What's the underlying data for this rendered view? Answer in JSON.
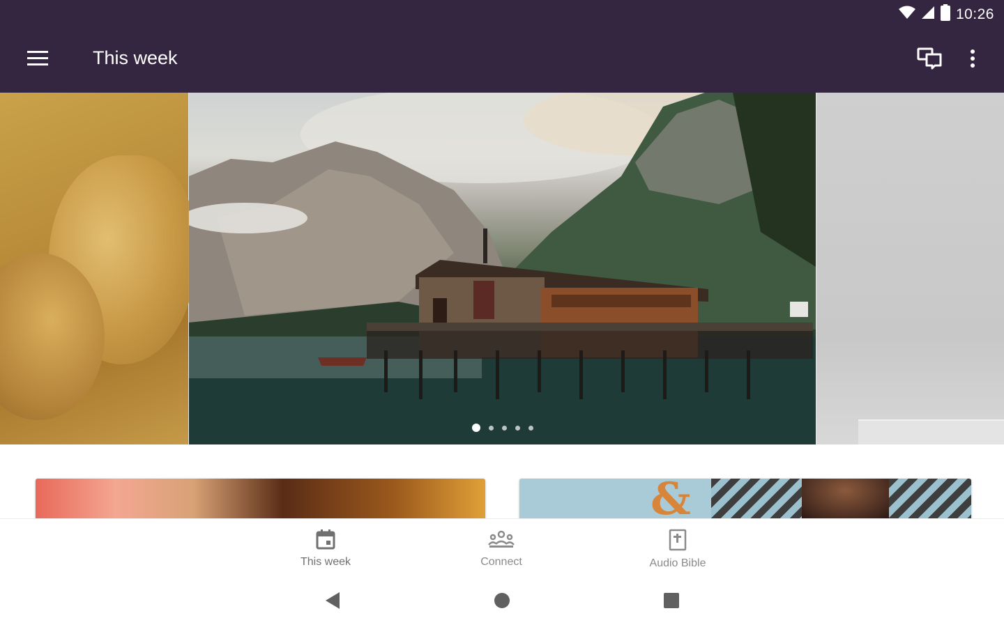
{
  "status_bar": {
    "time": "10:26",
    "icons": [
      "wifi-icon",
      "signal-icon",
      "battery-icon"
    ]
  },
  "app_bar": {
    "title": "This week",
    "icons": [
      "menu-icon",
      "chat-icon",
      "more-vert-icon"
    ]
  },
  "carousel": {
    "slides": 5,
    "active_index": 0
  },
  "bottom_nav": {
    "items": [
      {
        "label": "This week",
        "icon": "calendar-icon",
        "active": true
      },
      {
        "label": "Connect",
        "icon": "group-icon",
        "active": false
      },
      {
        "label": "Audio Bible",
        "icon": "bible-icon",
        "active": false
      }
    ]
  },
  "system_nav": {
    "icons": [
      "back-icon",
      "home-icon",
      "recents-icon"
    ]
  },
  "colors": {
    "app_bar": "#342640",
    "nav_inactive": "#8a8a8a"
  }
}
